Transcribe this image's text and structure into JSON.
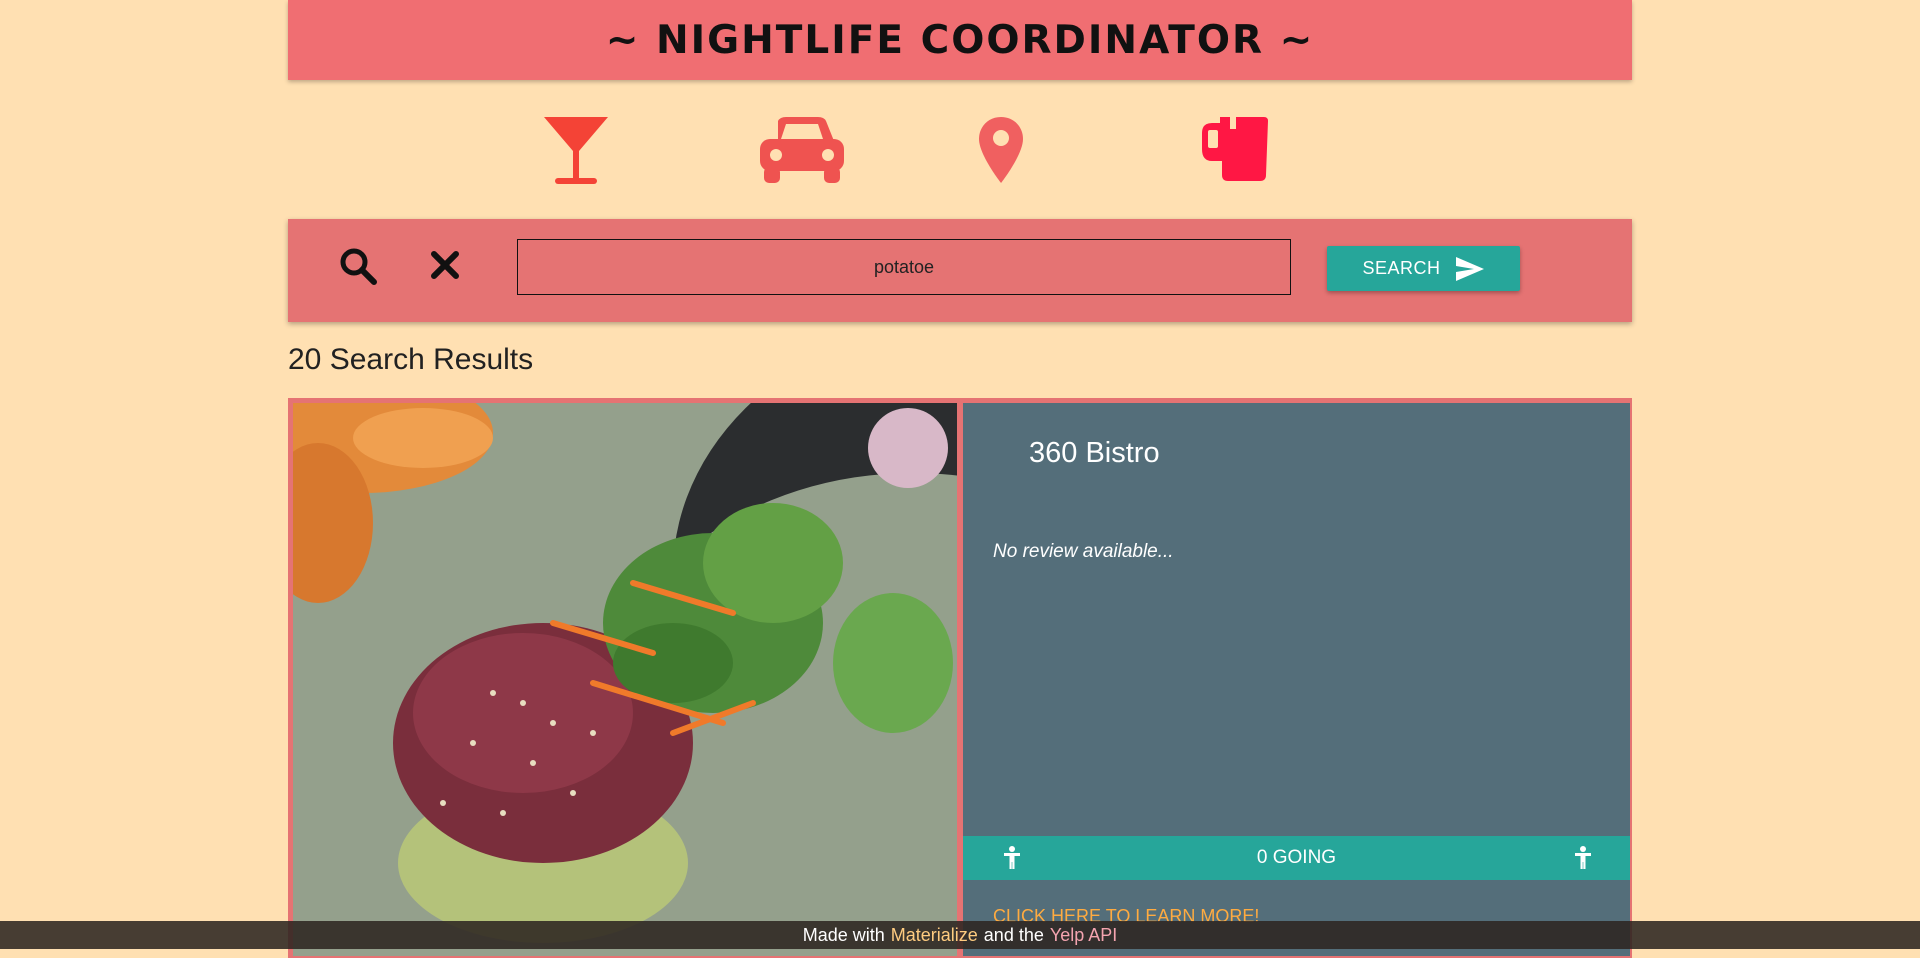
{
  "header": {
    "title": "~ NIGHTLIFE COORDINATOR ~"
  },
  "nav_icons": [
    {
      "name": "cocktail-icon",
      "color": "#f44336"
    },
    {
      "name": "car-icon",
      "color": "#ef5350"
    },
    {
      "name": "location-pin-icon",
      "color": "#f06060"
    },
    {
      "name": "beer-mug-icon",
      "color": "#ff1744"
    }
  ],
  "search": {
    "value": "potatoe",
    "search_icon": "search-icon",
    "clear_icon": "close-icon",
    "button_label": "SEARCH",
    "button_icon": "send-icon"
  },
  "results": {
    "count_label": "20 Search Results",
    "items": [
      {
        "name": "360 Bistro",
        "review": "No review available...",
        "going_label": "0 GOING",
        "learn_more": "CLICK HERE TO LEARN MORE!",
        "image_icon": "food-photo"
      }
    ]
  },
  "footer": {
    "prefix": "Made with",
    "link1": "Materialize",
    "middle": "and the",
    "link2": "Yelp API"
  },
  "colors": {
    "page_bg": "#ffe0b2",
    "title_bar": "#f06e72",
    "search_bar": "#e57373",
    "teal": "#26a69a",
    "card_info": "#546e7a",
    "link_orange": "#ffab40"
  }
}
